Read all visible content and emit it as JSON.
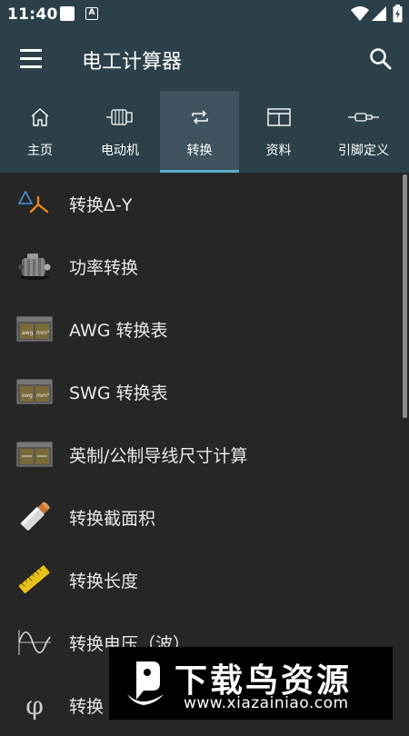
{
  "status": {
    "time": "11:40",
    "a_icon_letter": "A"
  },
  "appbar": {
    "title": "电工计算器"
  },
  "tabs": [
    {
      "label": "主页",
      "icon": "home-icon"
    },
    {
      "label": "电动机",
      "icon": "motor-icon"
    },
    {
      "label": "转换",
      "icon": "repeat-icon",
      "active": true
    },
    {
      "label": "资料",
      "icon": "table-icon"
    },
    {
      "label": "引脚定义",
      "icon": "connector-icon"
    }
  ],
  "list": {
    "items": [
      {
        "label": "转换Δ-Y",
        "icon": "delta-wye-icon"
      },
      {
        "label": "功率转换",
        "icon": "motor-image-icon"
      },
      {
        "label": "AWG 转换表",
        "icon": "awg-gauge-icon",
        "icon_text": "awg mm²"
      },
      {
        "label": "SWG 转换表",
        "icon": "swg-gauge-icon",
        "icon_text": "swg mm²"
      },
      {
        "label": "英制/公制导线尺寸计算",
        "icon": "wire-gauge-icon"
      },
      {
        "label": "转换截面积",
        "icon": "cable-cross-section-icon"
      },
      {
        "label": "转换长度",
        "icon": "ruler-icon"
      },
      {
        "label": "转换电压（波）",
        "icon": "sine-wave-icon"
      },
      {
        "label": "转换",
        "icon": "phi-icon",
        "icon_text": "φ"
      }
    ]
  },
  "watermark": {
    "brand": "下载鸟资源",
    "url": "www.xiazainiao.com"
  },
  "colors": {
    "toolbar": "#2c4049",
    "tab_active": "#3f545e",
    "indicator": "#5ab0cc",
    "background": "#262626",
    "text": "#e8e8e8"
  }
}
